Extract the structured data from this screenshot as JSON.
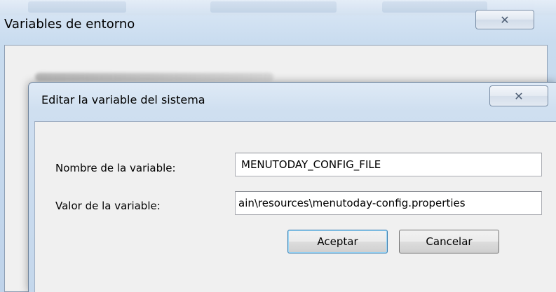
{
  "background_window": {
    "title": "Variables de entorno",
    "close_icon": "close-x-icon",
    "close_glyph": "✕"
  },
  "dialog": {
    "title": "Editar la variable del sistema",
    "close_icon": "close-x-icon",
    "close_glyph": "✕",
    "fields": {
      "name": {
        "label": "Nombre de la variable:",
        "value": "MENUTODAY_CONFIG_FILE"
      },
      "value": {
        "label": "Valor de la variable:",
        "value": "ain\\resources\\menutoday-config.properties"
      }
    },
    "buttons": {
      "ok_label": "Aceptar",
      "cancel_label": "Cancelar"
    }
  },
  "colors": {
    "title_bar": "#cfdff0",
    "client_bg": "#f0f0f0",
    "default_button_border": "#3c7fb1"
  }
}
